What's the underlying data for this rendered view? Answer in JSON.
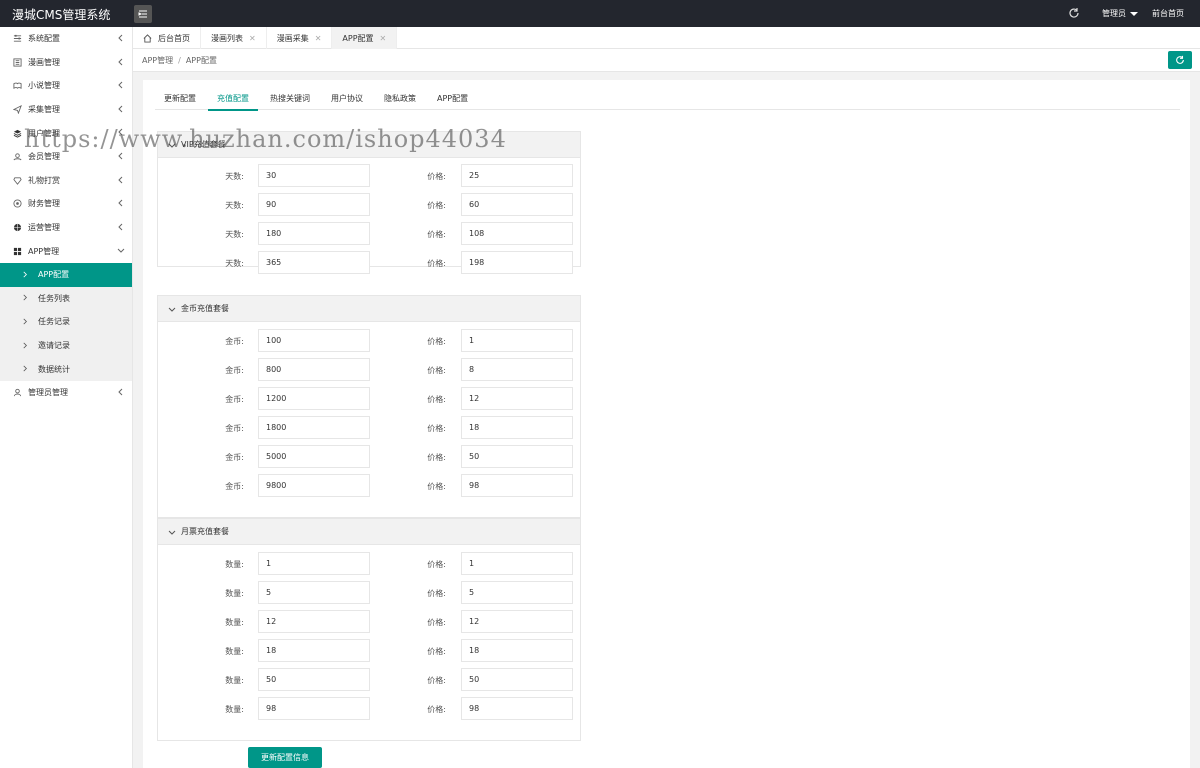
{
  "app": {
    "title": "漫城CMS管理系统",
    "admin_label": "管理员",
    "front_label": "前台首页"
  },
  "sidebar": {
    "items": [
      {
        "label": "系统配置",
        "icon": "sliders-icon"
      },
      {
        "label": "漫画管理",
        "icon": "book-icon"
      },
      {
        "label": "小说管理",
        "icon": "reader-icon"
      },
      {
        "label": "采集管理",
        "icon": "send-icon"
      },
      {
        "label": "用户管理",
        "icon": "layers-icon"
      },
      {
        "label": "会员管理",
        "icon": "user-circle-icon"
      },
      {
        "label": "礼物打赏",
        "icon": "diamond-icon"
      },
      {
        "label": "财务管理",
        "icon": "money-icon"
      },
      {
        "label": "运营管理",
        "icon": "globe-icon"
      },
      {
        "label": "APP管理",
        "icon": "windows-icon"
      }
    ],
    "sub_items": [
      {
        "label": "APP配置"
      },
      {
        "label": "任务列表"
      },
      {
        "label": "任务记录"
      },
      {
        "label": "邀请记录"
      },
      {
        "label": "数据统计"
      }
    ],
    "last_item": {
      "label": "管理员管理",
      "icon": "user-icon"
    }
  },
  "tabs": [
    {
      "label": "后台首页"
    },
    {
      "label": "漫画列表"
    },
    {
      "label": "漫画采集"
    },
    {
      "label": "APP配置"
    }
  ],
  "breadcrumb": {
    "parent": "APP管理",
    "separator": "/",
    "current": "APP配置"
  },
  "subtabs": [
    {
      "label": "更新配置"
    },
    {
      "label": "充值配置"
    },
    {
      "label": "热搜关键词"
    },
    {
      "label": "用户协议"
    },
    {
      "label": "隐私政策"
    },
    {
      "label": "APP配置"
    }
  ],
  "vip": {
    "title": "VIP充值套餐",
    "rows": [
      {
        "label": "天数:",
        "value": "30",
        "price_label": "价格:",
        "price": "25"
      },
      {
        "label": "天数:",
        "value": "90",
        "price_label": "价格:",
        "price": "60"
      },
      {
        "label": "天数:",
        "value": "180",
        "price_label": "价格:",
        "price": "108"
      },
      {
        "label": "天数:",
        "value": "365",
        "price_label": "价格:",
        "price": "198"
      }
    ]
  },
  "coins": {
    "title": "金币充值套餐",
    "rows": [
      {
        "label": "金币:",
        "value": "100",
        "price_label": "价格:",
        "price": "1"
      },
      {
        "label": "金币:",
        "value": "800",
        "price_label": "价格:",
        "price": "8"
      },
      {
        "label": "金币:",
        "value": "1200",
        "price_label": "价格:",
        "price": "12"
      },
      {
        "label": "金币:",
        "value": "1800",
        "price_label": "价格:",
        "price": "18"
      },
      {
        "label": "金币:",
        "value": "5000",
        "price_label": "价格:",
        "price": "50"
      },
      {
        "label": "金币:",
        "value": "9800",
        "price_label": "价格:",
        "price": "98"
      }
    ]
  },
  "tickets": {
    "title": "月票充值套餐",
    "rows": [
      {
        "label": "数量:",
        "value": "1",
        "price_label": "价格:",
        "price": "1"
      },
      {
        "label": "数量:",
        "value": "5",
        "price_label": "价格:",
        "price": "5"
      },
      {
        "label": "数量:",
        "value": "12",
        "price_label": "价格:",
        "price": "12"
      },
      {
        "label": "数量:",
        "value": "18",
        "price_label": "价格:",
        "price": "18"
      },
      {
        "label": "数量:",
        "value": "50",
        "price_label": "价格:",
        "price": "50"
      },
      {
        "label": "数量:",
        "value": "98",
        "price_label": "价格:",
        "price": "98"
      }
    ]
  },
  "submit_label": "更新配置信息",
  "watermark": "https://www.huzhan.com/ishop44034",
  "colors": {
    "accent": "#009688",
    "topbar": "#23262e"
  }
}
